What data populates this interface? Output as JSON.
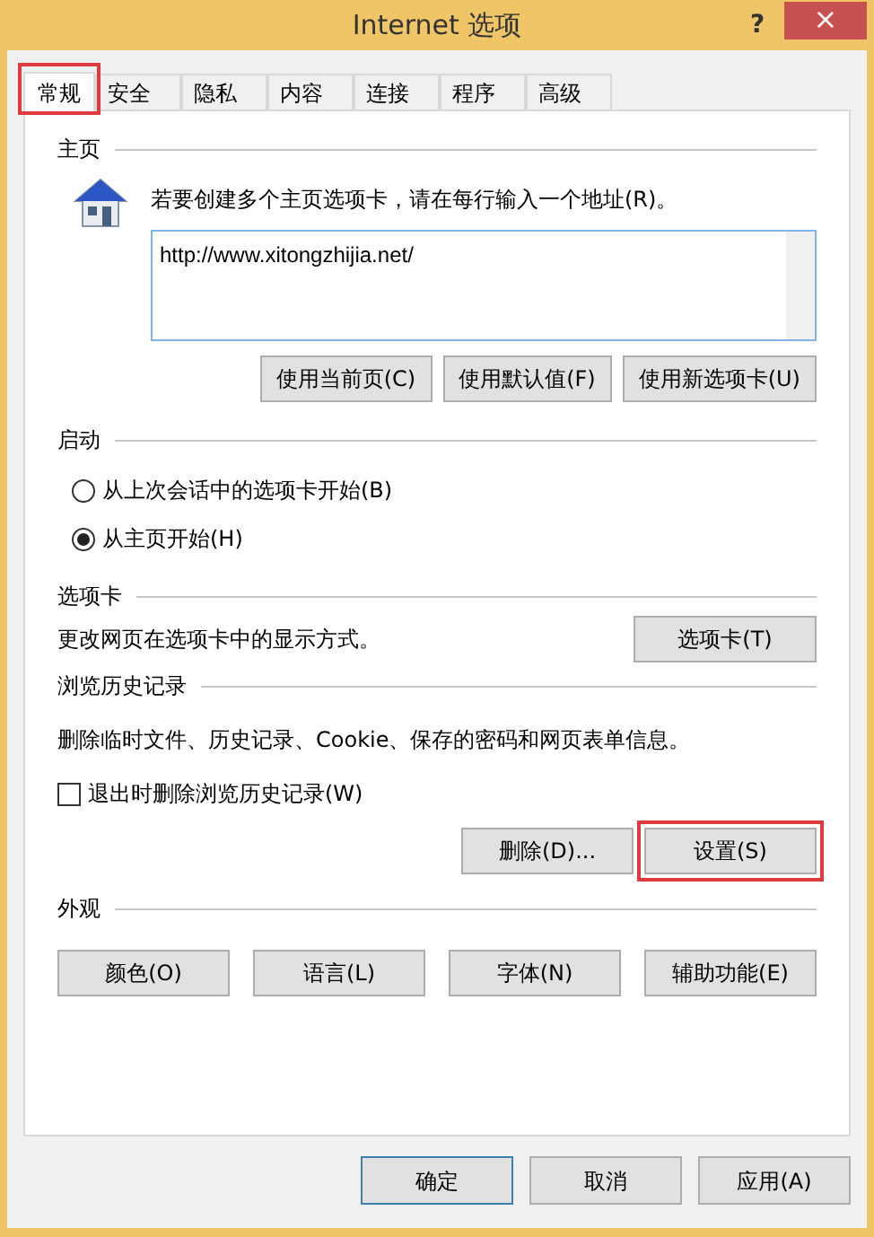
{
  "window": {
    "title": "Internet 选项",
    "help": "?",
    "close": "×"
  },
  "tabs": [
    {
      "label": "常规",
      "selected": true,
      "highlighted": true
    },
    {
      "label": "安全",
      "selected": false,
      "highlighted": false
    },
    {
      "label": "隐私",
      "selected": false,
      "highlighted": false
    },
    {
      "label": "内容",
      "selected": false,
      "highlighted": false
    },
    {
      "label": "连接",
      "selected": false,
      "highlighted": false
    },
    {
      "label": "程序",
      "selected": false,
      "highlighted": false
    },
    {
      "label": "高级",
      "selected": false,
      "highlighted": false
    }
  ],
  "home": {
    "heading": "主页",
    "hint": "若要创建多个主页选项卡，请在每行输入一个地址(R)。",
    "value": "http://www.xitongzhijia.net/",
    "buttons": [
      "使用当前页(C)",
      "使用默认值(F)",
      "使用新选项卡(U)"
    ]
  },
  "startup": {
    "heading": "启动",
    "options": [
      {
        "label": "从上次会话中的选项卡开始(B)",
        "selected": false
      },
      {
        "label": "从主页开始(H)",
        "selected": true
      }
    ]
  },
  "tabs_section": {
    "heading": "选项卡",
    "text": "更改网页在选项卡中的显示方式。",
    "button": "选项卡(T)"
  },
  "history": {
    "heading": "浏览历史记录",
    "text": "删除临时文件、历史记录、Cookie、保存的密码和网页表单信息。",
    "checkbox": {
      "label": "退出时删除浏览历史记录(W)",
      "checked": false
    },
    "buttons": [
      {
        "label": "删除(D)...",
        "highlighted": false
      },
      {
        "label": "设置(S)",
        "highlighted": true
      }
    ]
  },
  "appearance": {
    "heading": "外观",
    "buttons": [
      "颜色(O)",
      "语言(L)",
      "字体(N)",
      "辅助功能(E)"
    ]
  },
  "footer": [
    {
      "label": "确定",
      "default": true
    },
    {
      "label": "取消",
      "default": false
    },
    {
      "label": "应用(A)",
      "default": false
    }
  ]
}
